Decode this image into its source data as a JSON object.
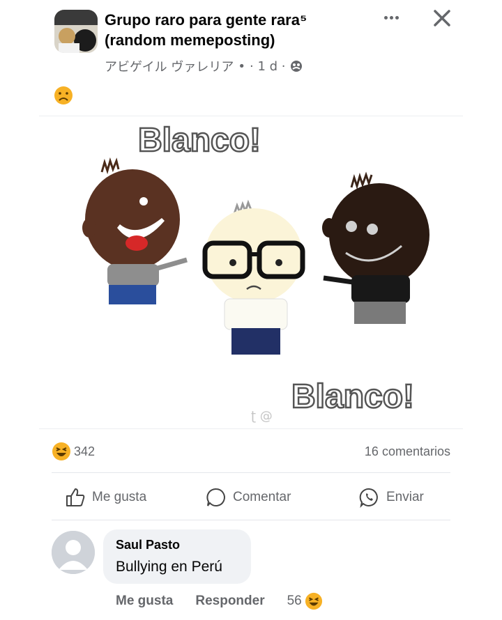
{
  "post": {
    "group_name": "Grupo raro para gente rara⁵ (random memeposting)",
    "author": "アビゲイル ヴァレリア",
    "separator_1": "•",
    "time": "· 1 d ·",
    "audience_icon": "members-icon",
    "feeling_icon": "sad-face-emoji"
  },
  "media": {
    "caption_top": "Blanco!",
    "caption_bottom": "Blanco!",
    "watermark": "ʈ @"
  },
  "stats": {
    "reaction_icon": "laughing-emoji",
    "reaction_count": "342",
    "comments": "16 comentarios"
  },
  "actions": {
    "like": "Me gusta",
    "comment": "Comentar",
    "send": "Enviar"
  },
  "comment": {
    "author": "Saul Pasto",
    "text": "Bullying en Perú",
    "like": "Me gusta",
    "reply": "Responder",
    "reaction_count": "56",
    "reaction_icon": "laughing-emoji"
  },
  "colors": {
    "secondary_text": "#65676b",
    "bubble_bg": "#f0f2f5",
    "emoji_yellow": "#f7b125"
  }
}
